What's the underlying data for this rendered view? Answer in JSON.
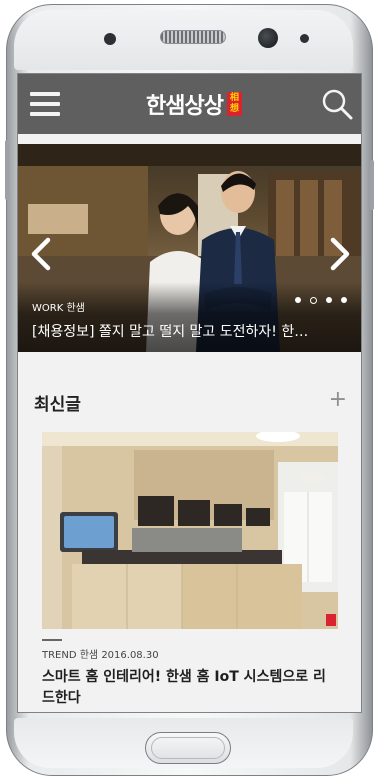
{
  "app": {
    "logo_text": "한샘상상",
    "logo_seal": [
      "相",
      "想"
    ]
  },
  "icons": {
    "menu": "hamburger-menu-icon",
    "search": "search-icon",
    "prev": "chevron-left-icon",
    "next": "chevron-right-icon",
    "more": "plus-icon"
  },
  "hero": {
    "tag": "WORK 한샘",
    "title": "[채용정보] 쫄지 말고 떨지 말고 도전하자! 한…",
    "slide_count": 4,
    "active_index": 1
  },
  "latest": {
    "title": "최신글",
    "more_label": "+"
  },
  "card": {
    "meta": "TREND 한샘 2016.08.30",
    "title": "스마트 홈 인테리어! 한샘 홈 IoT 시스템으로 리드한다"
  },
  "colors": {
    "appbar": "#5f5f5f",
    "seal_bg": "#d9232e",
    "seal_text": "#ffd200",
    "screen_bg": "#f2f2f2"
  }
}
